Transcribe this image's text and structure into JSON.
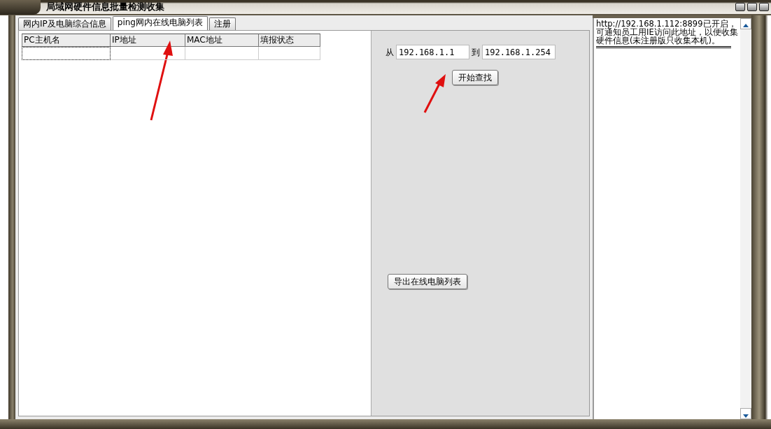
{
  "window": {
    "title": "局域网硬件信息批量检测收集"
  },
  "tabs": [
    {
      "label": "网内IP及电脑综合信息",
      "selected": false
    },
    {
      "label": "ping网内在线电脑列表",
      "selected": true
    },
    {
      "label": "注册",
      "selected": false
    }
  ],
  "table": {
    "columns": [
      "PC主机名",
      "IP地址",
      "MAC地址",
      "填报状态"
    ]
  },
  "range": {
    "from_label": "从",
    "from_value": "192.168.1.1",
    "to_label": "到",
    "to_value": "192.168.1.254"
  },
  "buttons": {
    "search": "开始查找",
    "export": "导出在线电脑列表"
  },
  "log": {
    "text": "http://192.168.1.112:8899已开启，可通知员工用IE访问此地址，以便收集硬件信息(未注册版只收集本机)。"
  }
}
